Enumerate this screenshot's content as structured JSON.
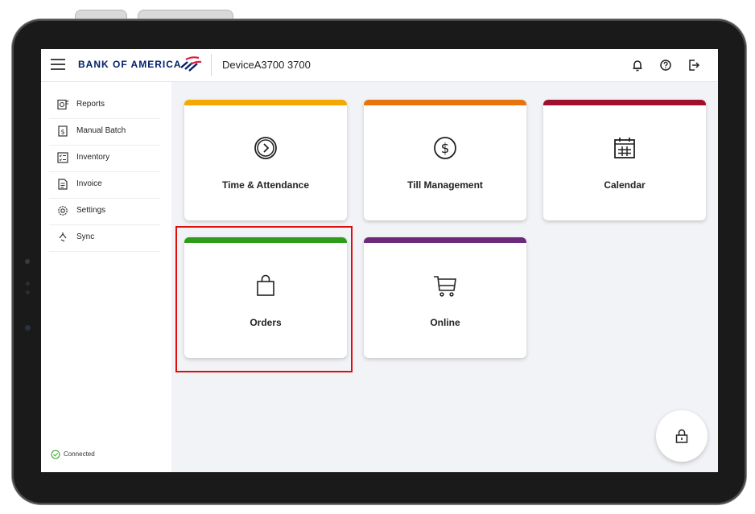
{
  "header": {
    "brand": "BANK OF AMERICA",
    "device_name": "DeviceA3700 3700"
  },
  "sidebar": {
    "items": [
      {
        "label": "Reports",
        "icon": "reports-icon"
      },
      {
        "label": "Manual Batch",
        "icon": "manual-batch-icon"
      },
      {
        "label": "Inventory",
        "icon": "inventory-icon"
      },
      {
        "label": "Invoice",
        "icon": "invoice-icon"
      },
      {
        "label": "Settings",
        "icon": "gear-icon"
      },
      {
        "label": "Sync",
        "icon": "sync-icon"
      }
    ],
    "status": "Connected"
  },
  "tiles": [
    {
      "label": "Time & Attendance",
      "color": "#f5a800",
      "icon": "clock-arrow-icon"
    },
    {
      "label": "Till Management",
      "color": "#e8740c",
      "icon": "dollar-icon"
    },
    {
      "label": "Calendar",
      "color": "#a0102c",
      "icon": "calendar-icon"
    },
    {
      "label": "Orders",
      "color": "#2e9e1a",
      "icon": "shopping-bag-icon"
    },
    {
      "label": "Online",
      "color": "#6b2a7a",
      "icon": "cart-icon"
    }
  ],
  "colors": {
    "brand": "#012169",
    "brand_red": "#e31837",
    "highlight": "#e00d0d",
    "status_ok": "#2e9e1a"
  }
}
